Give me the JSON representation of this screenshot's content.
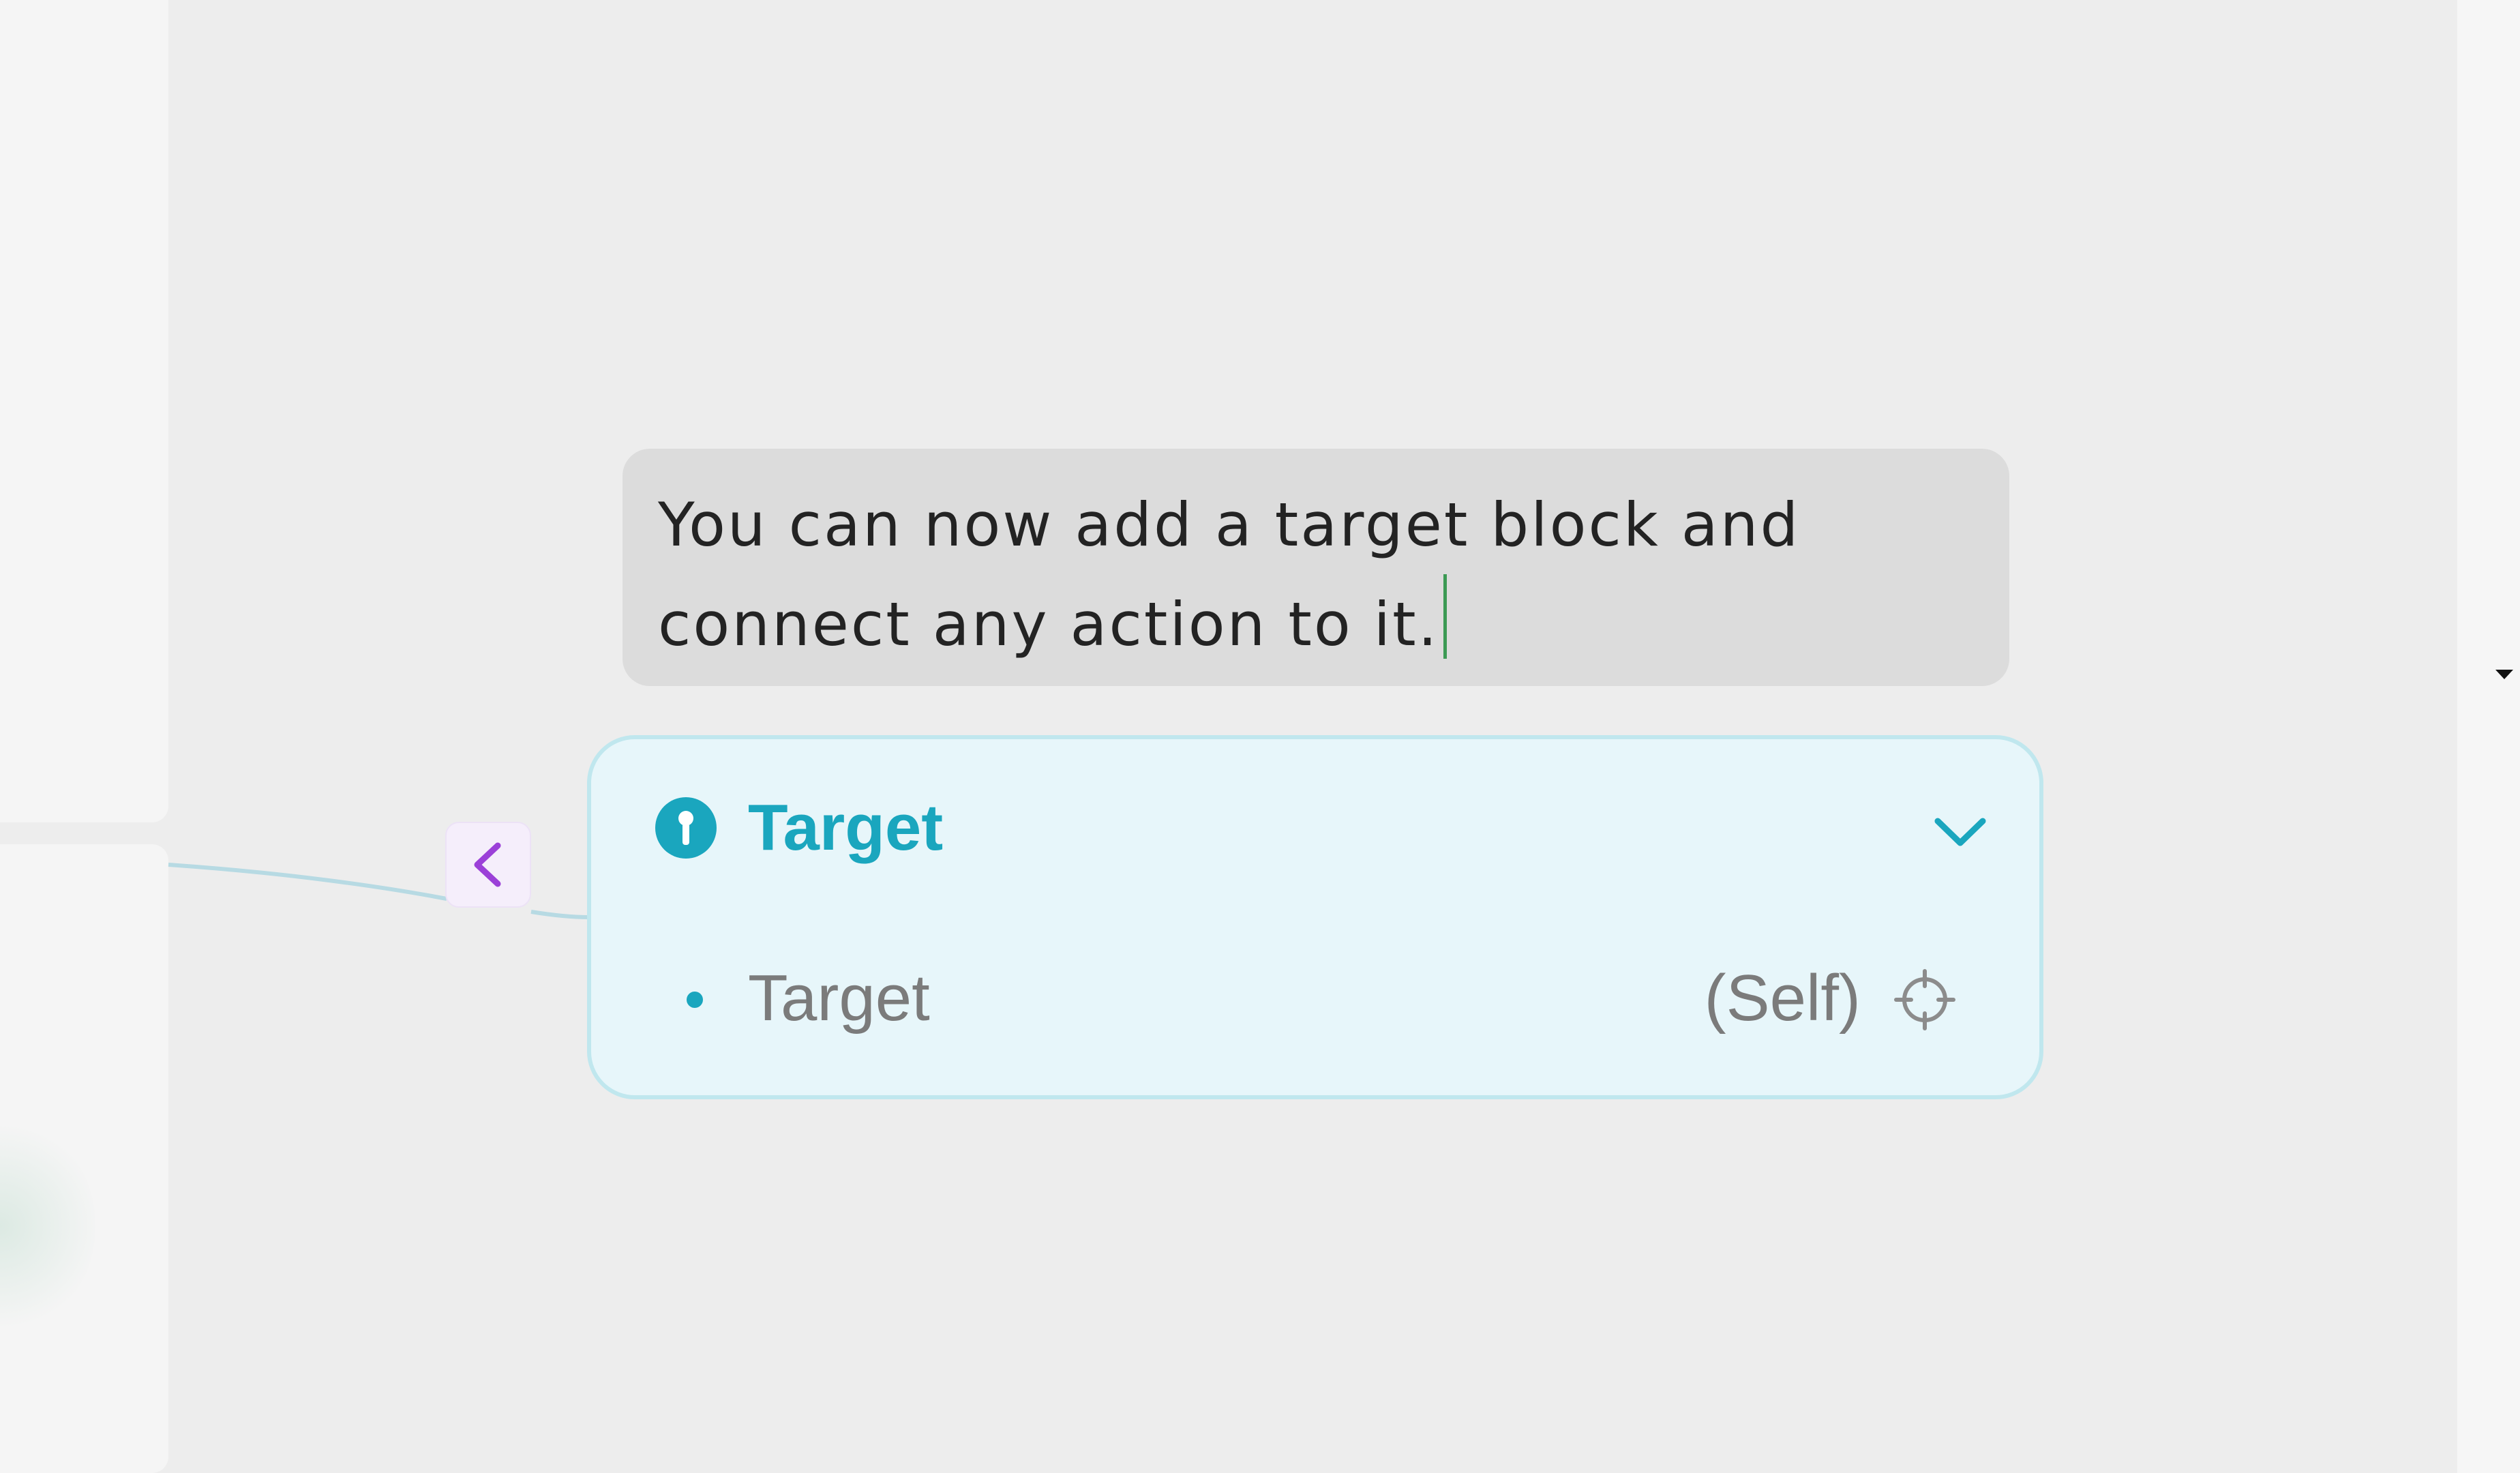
{
  "comment": {
    "text": "You can now add a target block and\nconnect any action to it."
  },
  "target_block": {
    "title": "Target",
    "header_icon": "target-info-icon",
    "expand_icon": "chevron-down-icon",
    "row": {
      "label": "Target",
      "value": "(Self)",
      "picker_icon": "crosshair-icon"
    }
  },
  "collapse_handle": {
    "icon": "chevron-left-icon"
  },
  "colors": {
    "accent_teal": "#1aa6be",
    "block_background": "#e7f6fa",
    "block_border": "#c0e7ee",
    "handle_purple": "#9b40d8",
    "caret_green": "#3c9a54",
    "bubble_background": "#dcdcdc"
  }
}
